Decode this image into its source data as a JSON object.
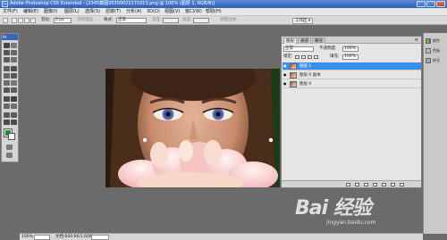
{
  "window": {
    "title": "Adobe Photoshop CS5 Extended - [2345截图20200021171013.png @ 100% (图层 1, RGB/8)]"
  },
  "menu": [
    "文件(F)",
    "编辑(E)",
    "图像(I)",
    "图层(L)",
    "选择(S)",
    "滤镜(T)",
    "分析(A)",
    "3D(D)",
    "视图(V)",
    "窗口(W)",
    "帮助(H)"
  ],
  "options": {
    "feather_label": "羽化:",
    "feather_value": "0 px",
    "antialias_label": "消除锯齿",
    "style_label": "样式:",
    "style_value": "正常",
    "width_label": "宽度:",
    "height_label": "高度:",
    "refine_edge": "调整边缘...",
    "workspace": "工作区 ▾"
  },
  "toolbox": {
    "header": "Ps",
    "foreground_color": "#1f8f2a",
    "background_color": "#ffffff"
  },
  "layers_panel": {
    "tabs": [
      "图层",
      "通道",
      "路径"
    ],
    "blend_mode": "正常",
    "opacity_label": "不透明度:",
    "opacity_value": "100%",
    "lock_label": "锁定:",
    "fill_label": "填充:",
    "fill_value": "100%",
    "layers": [
      {
        "name": "图层 1",
        "selected": true
      },
      {
        "name": "图层 0 副本",
        "selected": false
      },
      {
        "name": "图层 0",
        "selected": false
      }
    ]
  },
  "dock": [
    "颜色",
    "色板",
    "样式"
  ],
  "status": {
    "zoom": "100%",
    "doc_info": "文档:640.6K/1.60M"
  },
  "watermark": {
    "logo": "Bai 经验",
    "url": "jingyan.baidu.com"
  },
  "colors": {
    "accent": "#3d8ee8",
    "title_bar": "#2d5fb8"
  }
}
